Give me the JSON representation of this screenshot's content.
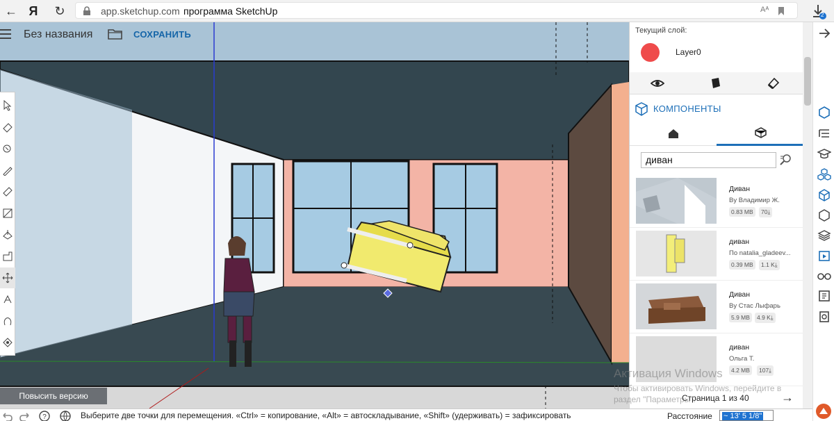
{
  "browser": {
    "back_icon": "arrow-left-icon",
    "yandex_logo": "Я",
    "domain": "app.sketchup.com",
    "page_title": "программа SketchUp",
    "download_badge": "2"
  },
  "app": {
    "doc_title": "Без названия",
    "save_label": "СОХРАНИТЬ",
    "upgrade_label": "Повысить версию"
  },
  "layers": {
    "caption": "Текущий слой:",
    "current_layer": "Layer0",
    "layer_color": "#ef4b4b"
  },
  "components": {
    "title": "КОМПОНЕНТЫ",
    "search_value": "диван",
    "results": [
      {
        "name": "Диван",
        "author": "By Владимир Ж.",
        "size": "0.83 MB",
        "downloads": "70⤓"
      },
      {
        "name": "диван",
        "author": "По natalia_gladeev...",
        "size": "0.39 MB",
        "downloads": "1.1 K⤓"
      },
      {
        "name": "Диван",
        "author": "By Стас Лыфарь",
        "size": "5.9 MB",
        "downloads": "4.9 K⤓"
      },
      {
        "name": "диван",
        "author": "Ольга Т.",
        "size": "4.2 MB",
        "downloads": "107⤓"
      }
    ],
    "pager": "Страница 1 из 40"
  },
  "status": {
    "hint": "Выберите две точки для перемещения. «Ctrl» = копирование, «Alt» = автоскладывание, «Shift» (удерживать) = зафиксировать",
    "distance_label": "Расстояние",
    "distance_value": "~ 13' 5 1/8\""
  },
  "watermark": {
    "title": "Активация Windows",
    "subtitle": "Чтобы активировать Windows, перейдите в раздел \"Параметры\"."
  },
  "colors": {
    "accent": "#1d6fb8",
    "wall_pink": "#f3b4a6",
    "floor": "#3a4a52",
    "sofa": "#f1ea6e"
  }
}
